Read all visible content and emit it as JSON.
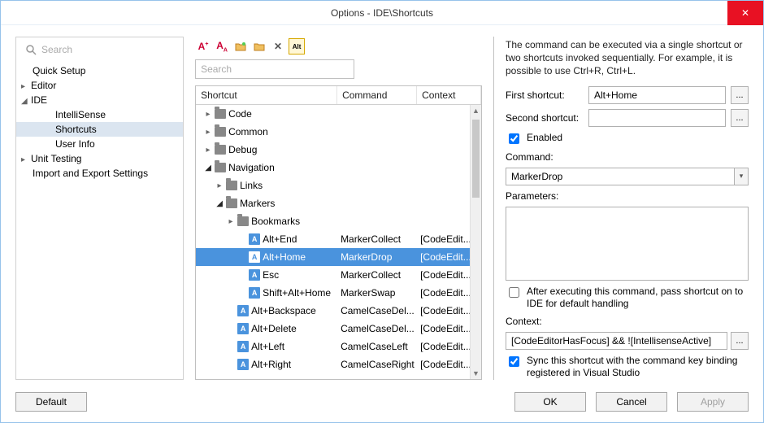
{
  "window": {
    "title": "Options - IDE\\Shortcuts",
    "close": "✕"
  },
  "search": {
    "placeholder": "Search"
  },
  "nav": {
    "items": [
      {
        "label": "Quick Setup",
        "cls": "top"
      },
      {
        "label": "Editor",
        "cls": "top",
        "arrow": "▸"
      },
      {
        "label": "IDE",
        "cls": "top",
        "arrow": "◢"
      },
      {
        "label": "IntelliSense",
        "cls": "sub"
      },
      {
        "label": "Shortcuts",
        "cls": "sub",
        "selected": true
      },
      {
        "label": "User Info",
        "cls": "sub"
      },
      {
        "label": "Unit Testing",
        "cls": "top",
        "arrow": "▸"
      },
      {
        "label": "Import and Export Settings",
        "cls": "top"
      }
    ]
  },
  "toolbar": {
    "icons": [
      "new-shortcut",
      "duplicate-shortcut",
      "new-folder",
      "rename",
      "delete",
      "alt"
    ]
  },
  "mid_search": {
    "placeholder": "Search"
  },
  "grid": {
    "headers": {
      "c1": "Shortcut",
      "c2": "Command",
      "c3": "Context"
    },
    "rows": [
      {
        "type": "folder",
        "label": "Code",
        "indent": 1,
        "open": false
      },
      {
        "type": "folder",
        "label": "Common",
        "indent": 1,
        "open": false
      },
      {
        "type": "folder",
        "label": "Debug",
        "indent": 1,
        "open": false
      },
      {
        "type": "folder",
        "label": "Navigation",
        "indent": 1,
        "open": true
      },
      {
        "type": "folder",
        "label": "Links",
        "indent": 2,
        "open": false
      },
      {
        "type": "folder",
        "label": "Markers",
        "indent": 2,
        "open": true
      },
      {
        "type": "folder",
        "label": "Bookmarks",
        "indent": 3,
        "open": false
      },
      {
        "type": "item",
        "label": "Alt+End",
        "cmd": "MarkerCollect",
        "ctx": "[CodeEdit...",
        "indent": 4
      },
      {
        "type": "item",
        "label": "Alt+Home",
        "cmd": "MarkerDrop",
        "ctx": "[CodeEdit...",
        "indent": 4,
        "selected": true
      },
      {
        "type": "item",
        "label": "Esc",
        "cmd": "MarkerCollect",
        "ctx": "[CodeEdit...",
        "indent": 4
      },
      {
        "type": "item",
        "label": "Shift+Alt+Home",
        "cmd": "MarkerSwap",
        "ctx": "[CodeEdit...",
        "indent": 4
      },
      {
        "type": "item",
        "label": "Alt+Backspace",
        "cmd": "CamelCaseDel...",
        "ctx": "[CodeEdit...",
        "indent": 3
      },
      {
        "type": "item",
        "label": "Alt+Delete",
        "cmd": "CamelCaseDel...",
        "ctx": "[CodeEdit...",
        "indent": 3
      },
      {
        "type": "item",
        "label": "Alt+Left",
        "cmd": "CamelCaseLeft",
        "ctx": "[CodeEdit...",
        "indent": 3
      },
      {
        "type": "item",
        "label": "Alt+Right",
        "cmd": "CamelCaseRight",
        "ctx": "[CodeEdit...",
        "indent": 3
      }
    ]
  },
  "detail": {
    "desc": "The command can be executed via a single shortcut or two shortcuts invoked sequentially. For example, it is possible to use Ctrl+R, Ctrl+L.",
    "first_label": "First shortcut:",
    "first_value": "Alt+Home",
    "second_label": "Second shortcut:",
    "second_value": "",
    "enabled_label": "Enabled",
    "enabled": true,
    "command_label": "Command:",
    "command_value": "MarkerDrop",
    "params_label": "Parameters:",
    "params_value": "",
    "pass_label": "After executing this command, pass shortcut on to IDE for default handling",
    "pass": false,
    "context_label": "Context:",
    "context_value": "[CodeEditorHasFocus] && ![IntellisenseActive]",
    "sync_label": "Sync this shortcut with the command key binding registered in Visual Studio",
    "sync": true
  },
  "footer": {
    "default": "Default",
    "ok": "OK",
    "cancel": "Cancel",
    "apply": "Apply"
  }
}
